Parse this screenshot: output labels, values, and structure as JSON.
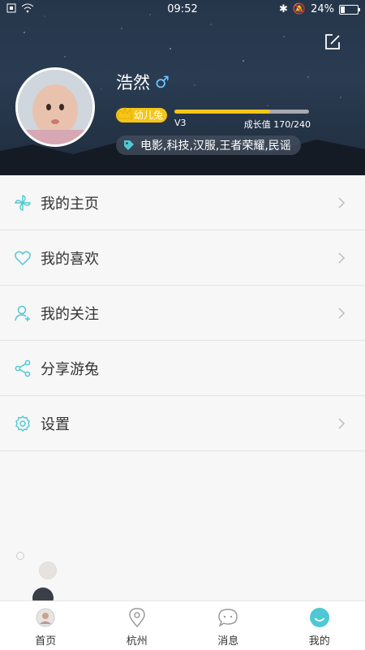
{
  "status_bar": {
    "time": "09:52",
    "battery": "24%",
    "battery_level": 0.24
  },
  "profile": {
    "nickname": "浩然",
    "gender_symbol": "♂",
    "level_badge": "幼儿兔",
    "level": "V3",
    "growth_label": "成长值 170/240",
    "growth_current": 170,
    "growth_max": 240,
    "interests": "电影,科技,汉服,王者荣耀,民谣"
  },
  "menu": {
    "items": [
      {
        "label": "我的主页",
        "icon": "pinwheel-icon"
      },
      {
        "label": "我的喜欢",
        "icon": "heart-icon"
      },
      {
        "label": "我的关注",
        "icon": "user-add-icon"
      },
      {
        "label": "分享游兔",
        "icon": "share-icon"
      },
      {
        "label": "设置",
        "icon": "gear-icon"
      }
    ]
  },
  "bottom_nav": {
    "items": [
      {
        "label": "首页",
        "icon": "home-avatar-icon"
      },
      {
        "label": "杭州",
        "icon": "location-pin-icon"
      },
      {
        "label": "消息",
        "icon": "message-bubble-icon"
      },
      {
        "label": "我的",
        "icon": "smile-icon",
        "active": true
      }
    ]
  },
  "colors": {
    "accent": "#4ec8d4",
    "badge": "#f5c518",
    "header_bg": "#26364a"
  }
}
